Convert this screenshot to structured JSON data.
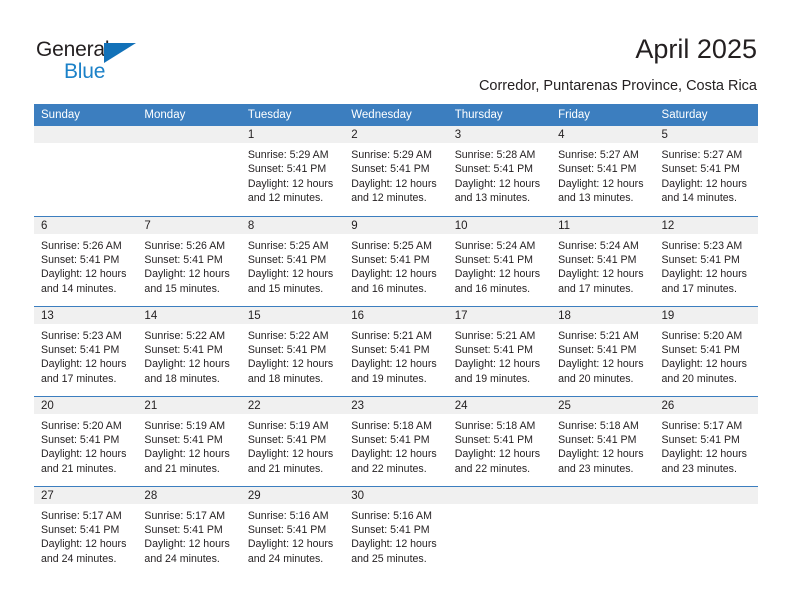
{
  "brand": {
    "name_top": "General",
    "name_bottom": "Blue",
    "triangle_icon": "triangle-icon",
    "accent_color": "#1271b8"
  },
  "header": {
    "title": "April 2025",
    "subtitle": "Corredor, Puntarenas Province, Costa Rica"
  },
  "colors": {
    "header_blue": "#3c7ebf",
    "daynum_band": "#f0f0f0",
    "text": "#231f20"
  },
  "calendar": {
    "weekday_headers": [
      "Sunday",
      "Monday",
      "Tuesday",
      "Wednesday",
      "Thursday",
      "Friday",
      "Saturday"
    ],
    "weeks": [
      [
        {
          "day": "",
          "lines": []
        },
        {
          "day": "",
          "lines": []
        },
        {
          "day": "1",
          "lines": [
            "Sunrise: 5:29 AM",
            "Sunset: 5:41 PM",
            "Daylight: 12 hours",
            "and 12 minutes."
          ]
        },
        {
          "day": "2",
          "lines": [
            "Sunrise: 5:29 AM",
            "Sunset: 5:41 PM",
            "Daylight: 12 hours",
            "and 12 minutes."
          ]
        },
        {
          "day": "3",
          "lines": [
            "Sunrise: 5:28 AM",
            "Sunset: 5:41 PM",
            "Daylight: 12 hours",
            "and 13 minutes."
          ]
        },
        {
          "day": "4",
          "lines": [
            "Sunrise: 5:27 AM",
            "Sunset: 5:41 PM",
            "Daylight: 12 hours",
            "and 13 minutes."
          ]
        },
        {
          "day": "5",
          "lines": [
            "Sunrise: 5:27 AM",
            "Sunset: 5:41 PM",
            "Daylight: 12 hours",
            "and 14 minutes."
          ]
        }
      ],
      [
        {
          "day": "6",
          "lines": [
            "Sunrise: 5:26 AM",
            "Sunset: 5:41 PM",
            "Daylight: 12 hours",
            "and 14 minutes."
          ]
        },
        {
          "day": "7",
          "lines": [
            "Sunrise: 5:26 AM",
            "Sunset: 5:41 PM",
            "Daylight: 12 hours",
            "and 15 minutes."
          ]
        },
        {
          "day": "8",
          "lines": [
            "Sunrise: 5:25 AM",
            "Sunset: 5:41 PM",
            "Daylight: 12 hours",
            "and 15 minutes."
          ]
        },
        {
          "day": "9",
          "lines": [
            "Sunrise: 5:25 AM",
            "Sunset: 5:41 PM",
            "Daylight: 12 hours",
            "and 16 minutes."
          ]
        },
        {
          "day": "10",
          "lines": [
            "Sunrise: 5:24 AM",
            "Sunset: 5:41 PM",
            "Daylight: 12 hours",
            "and 16 minutes."
          ]
        },
        {
          "day": "11",
          "lines": [
            "Sunrise: 5:24 AM",
            "Sunset: 5:41 PM",
            "Daylight: 12 hours",
            "and 17 minutes."
          ]
        },
        {
          "day": "12",
          "lines": [
            "Sunrise: 5:23 AM",
            "Sunset: 5:41 PM",
            "Daylight: 12 hours",
            "and 17 minutes."
          ]
        }
      ],
      [
        {
          "day": "13",
          "lines": [
            "Sunrise: 5:23 AM",
            "Sunset: 5:41 PM",
            "Daylight: 12 hours",
            "and 17 minutes."
          ]
        },
        {
          "day": "14",
          "lines": [
            "Sunrise: 5:22 AM",
            "Sunset: 5:41 PM",
            "Daylight: 12 hours",
            "and 18 minutes."
          ]
        },
        {
          "day": "15",
          "lines": [
            "Sunrise: 5:22 AM",
            "Sunset: 5:41 PM",
            "Daylight: 12 hours",
            "and 18 minutes."
          ]
        },
        {
          "day": "16",
          "lines": [
            "Sunrise: 5:21 AM",
            "Sunset: 5:41 PM",
            "Daylight: 12 hours",
            "and 19 minutes."
          ]
        },
        {
          "day": "17",
          "lines": [
            "Sunrise: 5:21 AM",
            "Sunset: 5:41 PM",
            "Daylight: 12 hours",
            "and 19 minutes."
          ]
        },
        {
          "day": "18",
          "lines": [
            "Sunrise: 5:21 AM",
            "Sunset: 5:41 PM",
            "Daylight: 12 hours",
            "and 20 minutes."
          ]
        },
        {
          "day": "19",
          "lines": [
            "Sunrise: 5:20 AM",
            "Sunset: 5:41 PM",
            "Daylight: 12 hours",
            "and 20 minutes."
          ]
        }
      ],
      [
        {
          "day": "20",
          "lines": [
            "Sunrise: 5:20 AM",
            "Sunset: 5:41 PM",
            "Daylight: 12 hours",
            "and 21 minutes."
          ]
        },
        {
          "day": "21",
          "lines": [
            "Sunrise: 5:19 AM",
            "Sunset: 5:41 PM",
            "Daylight: 12 hours",
            "and 21 minutes."
          ]
        },
        {
          "day": "22",
          "lines": [
            "Sunrise: 5:19 AM",
            "Sunset: 5:41 PM",
            "Daylight: 12 hours",
            "and 21 minutes."
          ]
        },
        {
          "day": "23",
          "lines": [
            "Sunrise: 5:18 AM",
            "Sunset: 5:41 PM",
            "Daylight: 12 hours",
            "and 22 minutes."
          ]
        },
        {
          "day": "24",
          "lines": [
            "Sunrise: 5:18 AM",
            "Sunset: 5:41 PM",
            "Daylight: 12 hours",
            "and 22 minutes."
          ]
        },
        {
          "day": "25",
          "lines": [
            "Sunrise: 5:18 AM",
            "Sunset: 5:41 PM",
            "Daylight: 12 hours",
            "and 23 minutes."
          ]
        },
        {
          "day": "26",
          "lines": [
            "Sunrise: 5:17 AM",
            "Sunset: 5:41 PM",
            "Daylight: 12 hours",
            "and 23 minutes."
          ]
        }
      ],
      [
        {
          "day": "27",
          "lines": [
            "Sunrise: 5:17 AM",
            "Sunset: 5:41 PM",
            "Daylight: 12 hours",
            "and 24 minutes."
          ]
        },
        {
          "day": "28",
          "lines": [
            "Sunrise: 5:17 AM",
            "Sunset: 5:41 PM",
            "Daylight: 12 hours",
            "and 24 minutes."
          ]
        },
        {
          "day": "29",
          "lines": [
            "Sunrise: 5:16 AM",
            "Sunset: 5:41 PM",
            "Daylight: 12 hours",
            "and 24 minutes."
          ]
        },
        {
          "day": "30",
          "lines": [
            "Sunrise: 5:16 AM",
            "Sunset: 5:41 PM",
            "Daylight: 12 hours",
            "and 25 minutes."
          ]
        },
        {
          "day": "",
          "lines": []
        },
        {
          "day": "",
          "lines": []
        },
        {
          "day": "",
          "lines": []
        }
      ]
    ]
  }
}
